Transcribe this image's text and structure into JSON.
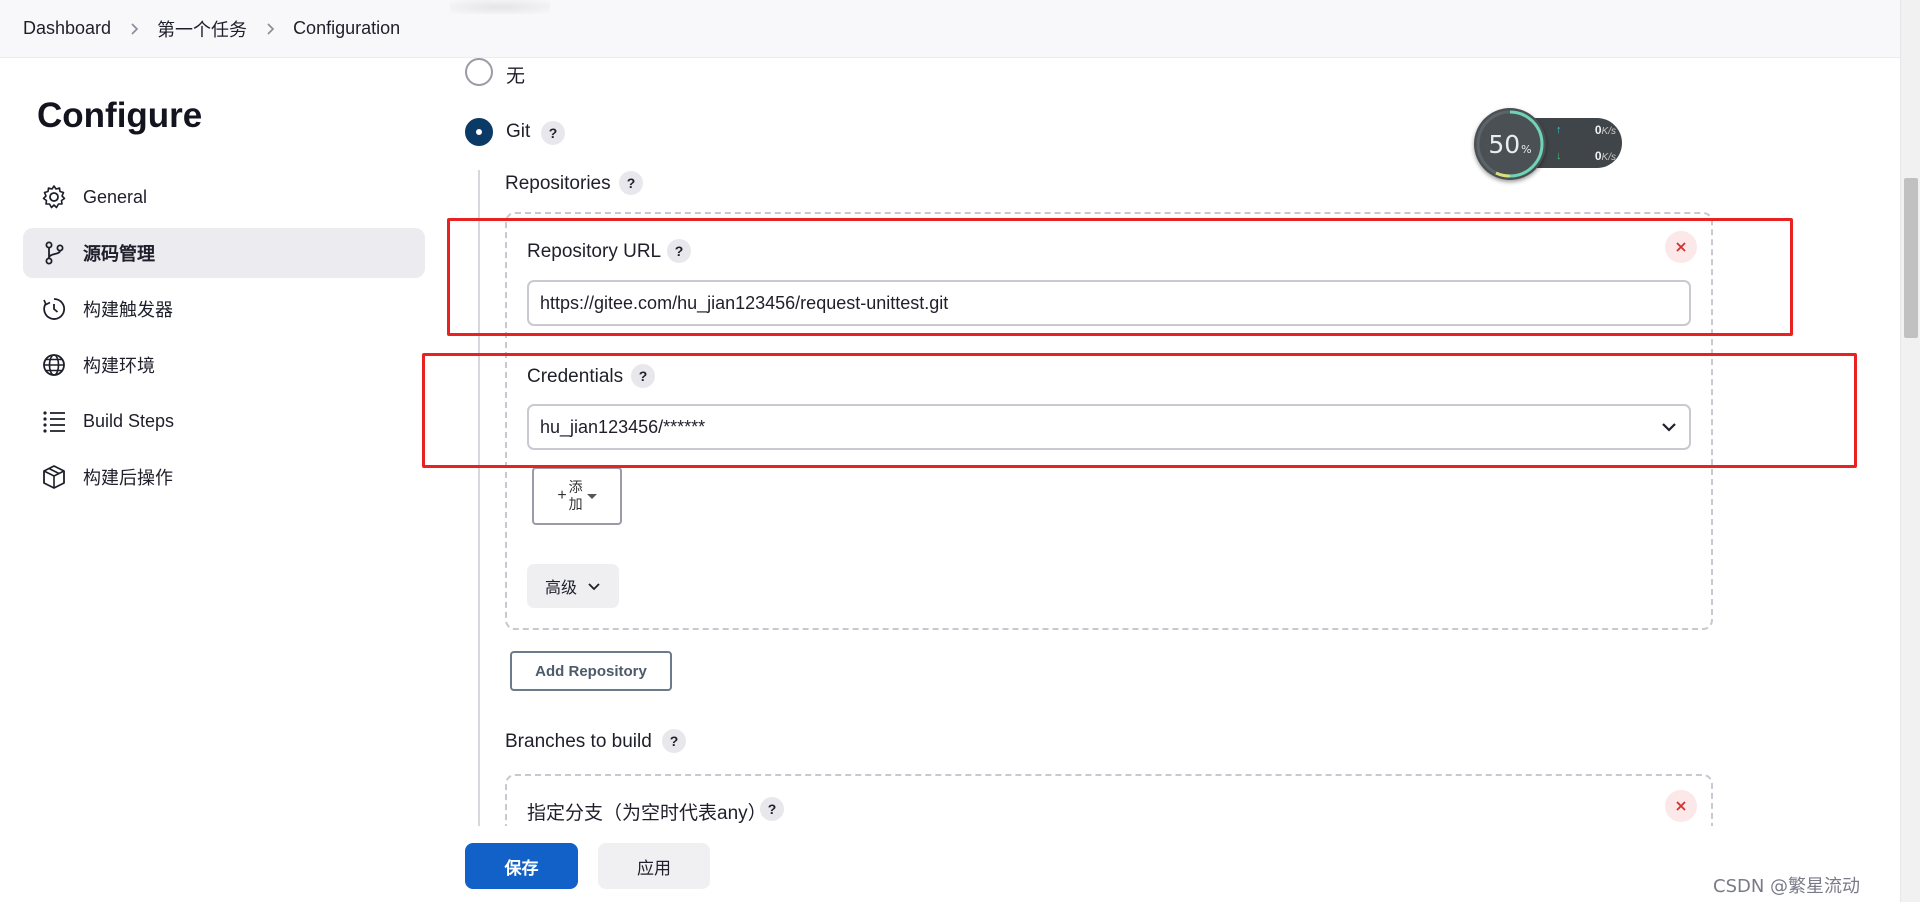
{
  "breadcrumb": {
    "items": [
      "Dashboard",
      "第一个任务",
      "Configuration"
    ]
  },
  "sidebar": {
    "title": "Configure",
    "items": [
      {
        "label": "General",
        "icon": "gear-icon",
        "active": false
      },
      {
        "label": "源码管理",
        "icon": "branch-icon",
        "active": true
      },
      {
        "label": "构建触发器",
        "icon": "clock-icon",
        "active": false
      },
      {
        "label": "构建环境",
        "icon": "globe-icon",
        "active": false
      },
      {
        "label": "Build Steps",
        "icon": "list-icon",
        "active": false
      },
      {
        "label": "构建后操作",
        "icon": "package-icon",
        "active": false
      }
    ]
  },
  "scm": {
    "options": [
      {
        "label": "无",
        "checked": false
      },
      {
        "label": "Git",
        "checked": true
      }
    ],
    "repositories_label": "Repositories",
    "repository_url_label": "Repository URL",
    "repository_url_value": "https://gitee.com/hu_jian123456/request-unittest.git",
    "credentials_label": "Credentials",
    "credentials_value": "hu_jian123456/******",
    "add_button": {
      "plus": "+",
      "line1": "添",
      "line2": "加"
    },
    "advanced_label": "高级",
    "add_repository_label": "Add Repository",
    "branches_label": "Branches to build",
    "branch_specifier_label": "指定分支（为空时代表any）",
    "help_symbol": "?"
  },
  "actions": {
    "save_label": "保存",
    "apply_label": "应用"
  },
  "net_widget": {
    "percent": "50",
    "percent_unit": "%",
    "upload_value": "0",
    "download_value": "0",
    "rate_unit": "K/s",
    "up_arrow": "↑",
    "down_arrow": "↓"
  },
  "watermark": "CSDN @繁星流动 >_<",
  "colors": {
    "accent_blue": "#1161c9",
    "radio_checked": "#0b3a66",
    "highlight_red": "#e82121",
    "close_red": "#d43030"
  }
}
